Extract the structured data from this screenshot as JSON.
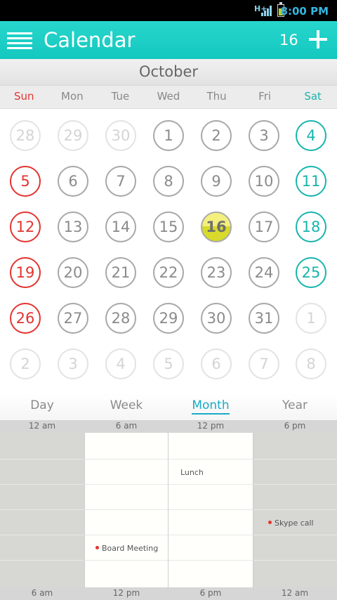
{
  "status_bar": {
    "network": "H+",
    "time": "8:00 PM",
    "battery_level": 0.6,
    "colors": {
      "time": "#36b6e0",
      "battery": "#b6d236"
    }
  },
  "app_bar": {
    "title": "Calendar",
    "today_number": "16",
    "menu_icon": "hamburger-menu-icon",
    "add_icon": "plus-icon",
    "color": "#14c8bf"
  },
  "month": {
    "name": "October"
  },
  "weekdays": [
    "Sun",
    "Mon",
    "Tue",
    "Wed",
    "Thu",
    "Fri",
    "Sat"
  ],
  "weeks": [
    [
      "28",
      "29",
      "30",
      "1",
      "2",
      "3",
      "4"
    ],
    [
      "5",
      "6",
      "7",
      "8",
      "9",
      "10",
      "11"
    ],
    [
      "12",
      "13",
      "14",
      "15",
      "16",
      "17",
      "18"
    ],
    [
      "19",
      "20",
      "21",
      "22",
      "23",
      "24",
      "25"
    ],
    [
      "26",
      "27",
      "28",
      "29",
      "30",
      "31",
      "1"
    ],
    [
      "2",
      "3",
      "4",
      "5",
      "6",
      "7",
      "8"
    ]
  ],
  "today": "16",
  "colors": {
    "sunday": "#e3342f",
    "saturday": "#17b5ad",
    "today_fill": "#e0e23a",
    "active_tab": "#19aac7"
  },
  "tabs": [
    {
      "label": "Day",
      "active": false
    },
    {
      "label": "Week",
      "active": false
    },
    {
      "label": "Month",
      "active": true
    },
    {
      "label": "Year",
      "active": false
    }
  ],
  "timeline": {
    "top_labels": [
      "12 am",
      "6 am",
      "12 pm",
      "6 pm"
    ],
    "bottom_labels": [
      "6 am",
      "12 pm",
      "6 pm",
      "12 am"
    ],
    "events": [
      {
        "title": "Lunch",
        "marker": false
      },
      {
        "title": "Skype call",
        "marker": true
      },
      {
        "title": "Board Meeting",
        "marker": true
      }
    ]
  }
}
